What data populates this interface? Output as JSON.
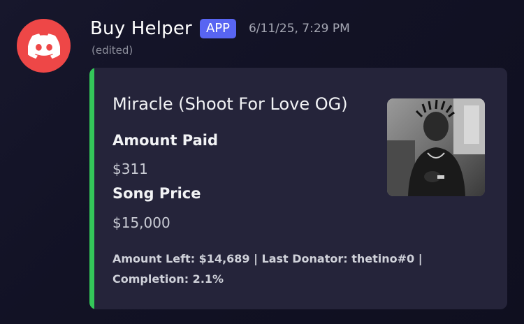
{
  "message": {
    "author": "Buy Helper",
    "badge": "APP",
    "timestamp": "6/11/25, 7:29 PM",
    "edited_label": "(edited)",
    "avatar_icon": "discord-logo-icon"
  },
  "embed": {
    "accent_color": "#34c759",
    "title": "Miracle (Shoot For Love OG)",
    "fields": [
      {
        "name": "Amount Paid",
        "value": "$311"
      },
      {
        "name": "Song Price",
        "value": "$15,000"
      }
    ],
    "footer_line1": "Amount Left: $14,689 | Last Donator: thetino#0 |",
    "footer_line2": "Completion: 2.1%",
    "thumbnail": "artist-photo"
  },
  "colors": {
    "avatar_bg": "#ee4747",
    "badge_bg": "#5865f2",
    "embed_bg": "#25243a"
  }
}
